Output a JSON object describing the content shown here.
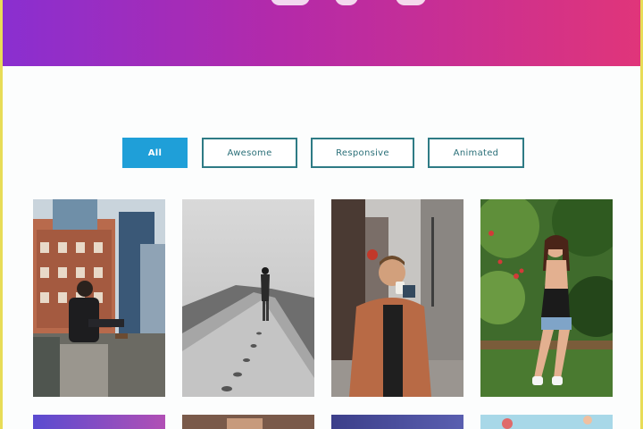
{
  "filters": {
    "all": "All",
    "awesome": "Awesome",
    "responsive": "Responsive",
    "animated": "Animated",
    "active": "All"
  },
  "gallery": {
    "photos": [
      {
        "subject": "man sitting on rooftop ledge with city buildings"
      },
      {
        "subject": "woman walking across sand dune, black and white"
      },
      {
        "subject": "man in jacket drinking coffee on street"
      },
      {
        "subject": "woman sitting on bench in garden"
      }
    ]
  },
  "colors": {
    "hero_start": "#8a2fd0",
    "hero_end": "#e0357a",
    "active_filter": "#1f9fd8",
    "filter_border": "#2e7b85"
  }
}
